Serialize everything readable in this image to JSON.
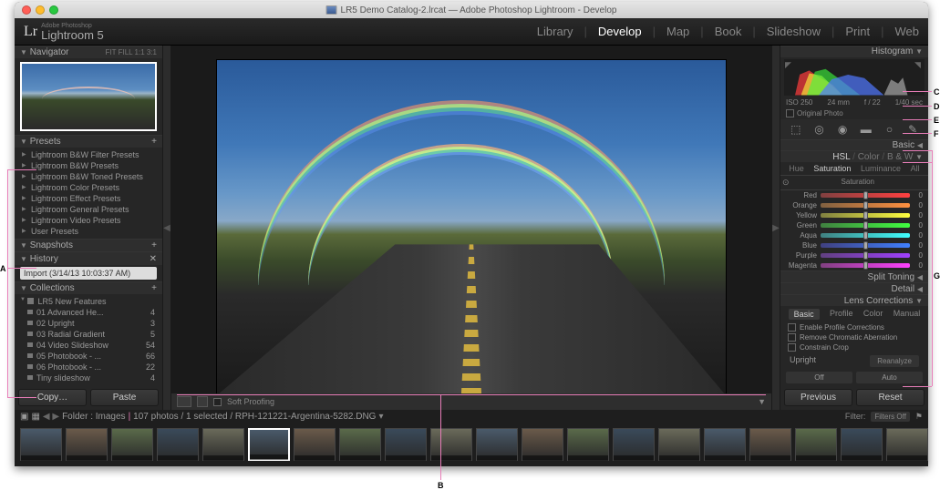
{
  "window_title": "LR5 Demo Catalog-2.lrcat — Adobe Photoshop Lightroom - Develop",
  "logo": {
    "brand": "Adobe Photoshop",
    "product": "Lightroom 5"
  },
  "modules": [
    "Library",
    "Develop",
    "Map",
    "Book",
    "Slideshow",
    "Print",
    "Web"
  ],
  "active_module": "Develop",
  "left_panels": {
    "navigator": {
      "title": "Navigator",
      "modes": "FIT   FILL   1:1   3:1"
    },
    "presets": {
      "title": "Presets",
      "items": [
        "Lightroom B&W Filter Presets",
        "Lightroom B&W Presets",
        "Lightroom B&W Toned Presets",
        "Lightroom Color Presets",
        "Lightroom Effect Presets",
        "Lightroom General Presets",
        "Lightroom Video Presets",
        "User Presets"
      ]
    },
    "snapshots": {
      "title": "Snapshots"
    },
    "history": {
      "title": "History",
      "current": "Import (3/14/13 10:03:37 AM)"
    },
    "collections": {
      "title": "Collections",
      "folder": "LR5 New Features",
      "items": [
        {
          "name": "01 Advanced He...",
          "count": 4
        },
        {
          "name": "02 Upright",
          "count": 3
        },
        {
          "name": "03 Radial Gradient",
          "count": 5
        },
        {
          "name": "04 Video Slideshow",
          "count": 54
        },
        {
          "name": "05 Photobook - ...",
          "count": 66
        },
        {
          "name": "06 Photobook - ...",
          "count": 22
        },
        {
          "name": "Tiny slideshow",
          "count": 4
        }
      ]
    },
    "buttons": {
      "copy": "Copy…",
      "paste": "Paste"
    }
  },
  "toolbar": {
    "soft_proofing": "Soft Proofing"
  },
  "right_panels": {
    "histogram": {
      "title": "Histogram",
      "iso": "ISO 250",
      "focal": "24 mm",
      "aperture": "f / 22",
      "shutter": "1/40 sec",
      "original": "Original Photo"
    },
    "basic": {
      "title": "Basic"
    },
    "hsl": {
      "title_parts": [
        "HSL",
        "Color",
        "B & W"
      ],
      "tabs": [
        "Hue",
        "Saturation",
        "Luminance",
        "All"
      ],
      "active_tab": "Saturation",
      "section_label": "Saturation",
      "sliders": [
        {
          "name": "Red",
          "val": 0,
          "grad": "linear-gradient(to right,#804040,#ff4040)"
        },
        {
          "name": "Orange",
          "val": 0,
          "grad": "linear-gradient(to right,#806040,#ff9040)"
        },
        {
          "name": "Yellow",
          "val": 0,
          "grad": "linear-gradient(to right,#808040,#ffff40)"
        },
        {
          "name": "Green",
          "val": 0,
          "grad": "linear-gradient(to right,#408040,#40ff40)"
        },
        {
          "name": "Aqua",
          "val": 0,
          "grad": "linear-gradient(to right,#408080,#40ffff)"
        },
        {
          "name": "Blue",
          "val": 0,
          "grad": "linear-gradient(to right,#404080,#4080ff)"
        },
        {
          "name": "Purple",
          "val": 0,
          "grad": "linear-gradient(to right,#604080,#a040ff)"
        },
        {
          "name": "Magenta",
          "val": 0,
          "grad": "linear-gradient(to right,#804080,#ff40ff)"
        }
      ]
    },
    "split_toning": {
      "title": "Split Toning"
    },
    "detail": {
      "title": "Detail"
    },
    "lens": {
      "title": "Lens Corrections",
      "tabs": [
        "Basic",
        "Profile",
        "Color",
        "Manual"
      ],
      "active_tab": "Basic",
      "checks": [
        "Enable Profile Corrections",
        "Remove Chromatic Aberration",
        "Constrain Crop"
      ],
      "upright_label": "Upright",
      "reanalyze": "Reanalyze",
      "off": "Off",
      "auto": "Auto"
    },
    "buttons": {
      "previous": "Previous",
      "reset": "Reset"
    }
  },
  "filmstrip": {
    "path": "Folder : Images",
    "info": "107 photos / 1 selected / RPH-121221-Argentina-5282.DNG",
    "filter": "Filter:",
    "filters_off": "Filters Off",
    "count": 20
  },
  "annotations": {
    "A": "A",
    "B": "B",
    "C": "C",
    "D": "D",
    "E": "E",
    "F": "F",
    "G": "G"
  }
}
